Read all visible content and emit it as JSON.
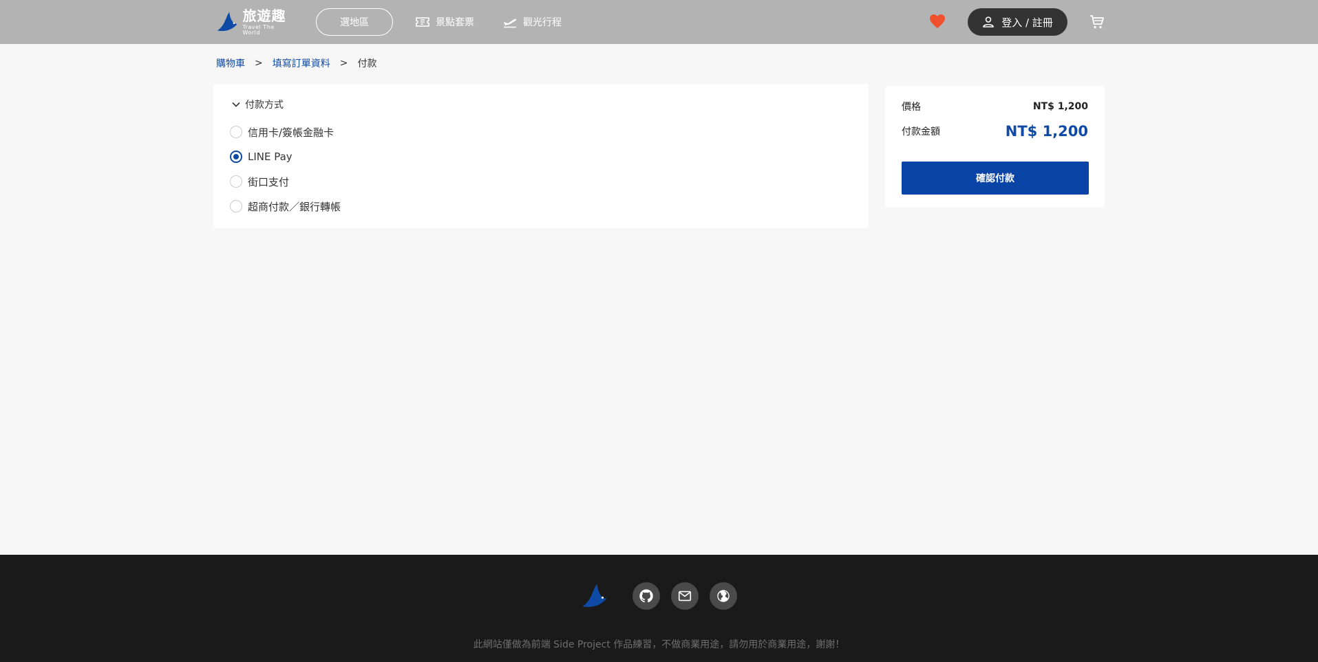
{
  "header": {
    "logo_name": "旅遊趣",
    "logo_sub": "Travel The World",
    "region_button": "選地區",
    "nav": [
      {
        "label": "景點套票",
        "icon": "ticket-icon"
      },
      {
        "label": "觀光行程",
        "icon": "plane-icon"
      }
    ],
    "login_label": "登入 / 註冊"
  },
  "breadcrumb": {
    "items": [
      "購物車",
      "填寫訂單資料"
    ],
    "separator": ">",
    "current": "付款"
  },
  "payment": {
    "title": "付款方式",
    "options": [
      {
        "label": "信用卡/簽帳金融卡",
        "selected": false
      },
      {
        "label": "LINE Pay",
        "selected": true
      },
      {
        "label": "街口支付",
        "selected": false
      },
      {
        "label": "超商付款／銀行轉帳",
        "selected": false
      }
    ]
  },
  "summary": {
    "price_label": "價格",
    "price_value": "NT$ 1,200",
    "total_label": "付款金額",
    "total_value": "NT$ 1,200",
    "confirm_label": "確認付款"
  },
  "footer": {
    "note": "此網站僅做為前端 Side Project 作品練習，不做商業用途，請勿用於商業用途，謝謝！",
    "social": [
      "github-icon",
      "mail-icon",
      "globe-icon"
    ]
  },
  "colors": {
    "accent": "#0f4aa6",
    "header_bg": "#b3b3b3",
    "heart": "#f0502e",
    "footer_bg": "#1a1a1a"
  }
}
